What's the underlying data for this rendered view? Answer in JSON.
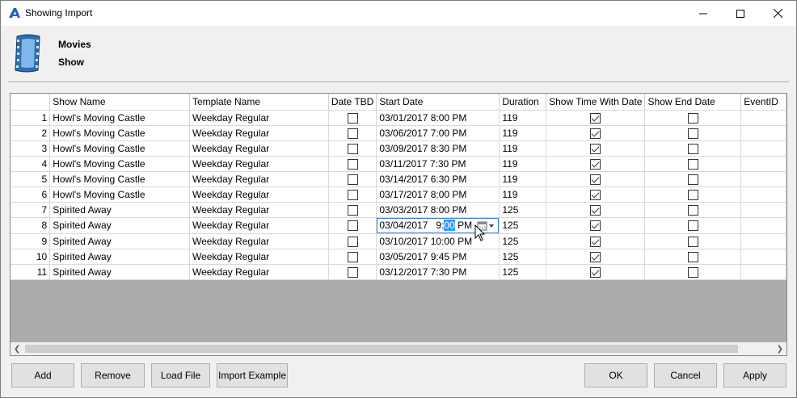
{
  "window": {
    "title": "Showing Import"
  },
  "header": {
    "line1": "Movies",
    "line2": "Show"
  },
  "grid": {
    "columns": [
      "Show Name",
      "Template Name",
      "Date TBD",
      "Start Date",
      "Duration",
      "Show Time With Date",
      "Show End Date",
      "EventID"
    ],
    "rows": [
      {
        "num": "1",
        "show": "Howl's Moving Castle",
        "template": "Weekday Regular",
        "tbd": false,
        "start": "03/01/2017 8:00 PM",
        "duration": "119",
        "time_with_date": true,
        "end_date": false
      },
      {
        "num": "2",
        "show": "Howl's Moving Castle",
        "template": "Weekday Regular",
        "tbd": false,
        "start": "03/06/2017 7:00 PM",
        "duration": "119",
        "time_with_date": true,
        "end_date": false
      },
      {
        "num": "3",
        "show": "Howl's Moving Castle",
        "template": "Weekday Regular",
        "tbd": false,
        "start": "03/09/2017 8:30 PM",
        "duration": "119",
        "time_with_date": true,
        "end_date": false
      },
      {
        "num": "4",
        "show": "Howl's Moving Castle",
        "template": "Weekday Regular",
        "tbd": false,
        "start": "03/11/2017 7:30 PM",
        "duration": "119",
        "time_with_date": true,
        "end_date": false
      },
      {
        "num": "5",
        "show": "Howl's Moving Castle",
        "template": "Weekday Regular",
        "tbd": false,
        "start": "03/14/2017 6:30 PM",
        "duration": "119",
        "time_with_date": true,
        "end_date": false
      },
      {
        "num": "6",
        "show": "Howl's Moving Castle",
        "template": "Weekday Regular",
        "tbd": false,
        "start": "03/17/2017 8:00 PM",
        "duration": "119",
        "time_with_date": true,
        "end_date": false
      },
      {
        "num": "7",
        "show": "Spirited Away",
        "template": "Weekday Regular",
        "tbd": false,
        "start": "03/03/2017 8:00 PM",
        "duration": "125",
        "time_with_date": true,
        "end_date": false
      },
      {
        "num": "8",
        "show": "Spirited Away",
        "template": "Weekday Regular",
        "tbd": false,
        "start": "",
        "duration": "125",
        "time_with_date": true,
        "end_date": false,
        "editing": true
      },
      {
        "num": "9",
        "show": "Spirited Away",
        "template": "Weekday Regular",
        "tbd": false,
        "start": "03/10/2017 10:00 PM",
        "duration": "125",
        "time_with_date": true,
        "end_date": false
      },
      {
        "num": "10",
        "show": "Spirited Away",
        "template": "Weekday Regular",
        "tbd": false,
        "start": "03/05/2017 9:45 PM",
        "duration": "125",
        "time_with_date": true,
        "end_date": false
      },
      {
        "num": "11",
        "show": "Spirited Away",
        "template": "Weekday Regular",
        "tbd": false,
        "start": "03/12/2017 7:30 PM",
        "duration": "125",
        "time_with_date": true,
        "end_date": false
      }
    ],
    "editor": {
      "before": "03/04/2017   9:",
      "selected": "00",
      "after": " PM",
      "icon": "calendar-dropdown-icon"
    }
  },
  "buttons": {
    "add": "Add",
    "remove": "Remove",
    "load_file": "Load File",
    "import_example": "Import Example",
    "ok": "OK",
    "cancel": "Cancel",
    "apply": "Apply"
  },
  "icons": {
    "app": "app-logo-icon",
    "film": "film-strip-icon",
    "minimize": "minimize-icon",
    "maximize": "maximize-icon",
    "close": "close-icon"
  },
  "colors": {
    "selection": "#3399ff",
    "grid_background": "#ababab",
    "app_icon": "#1f5fbf"
  }
}
